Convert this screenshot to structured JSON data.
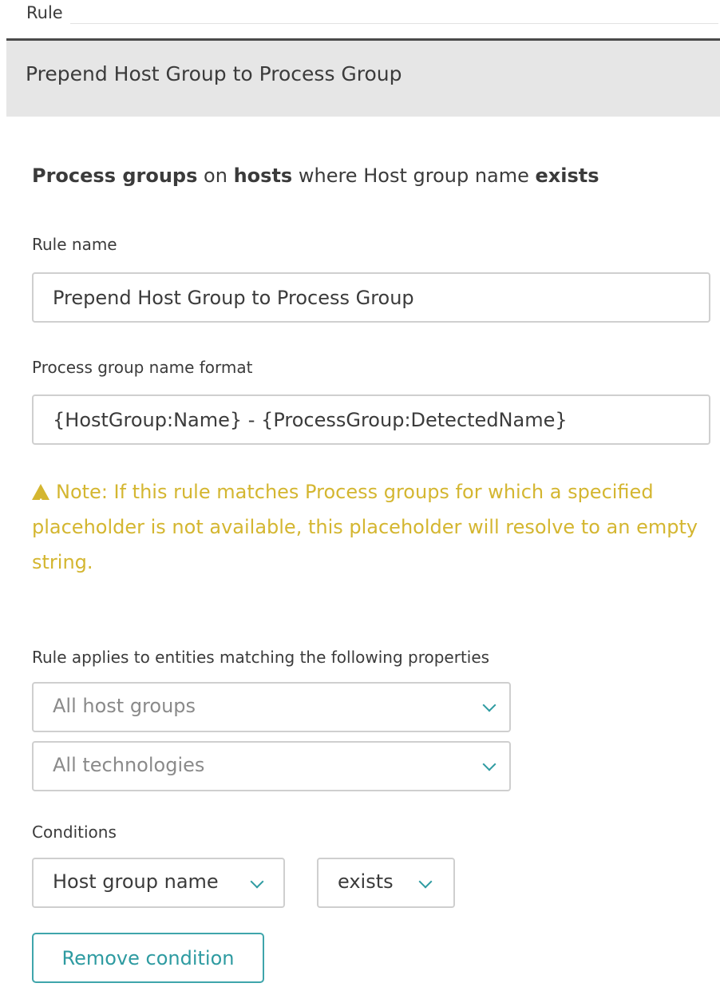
{
  "header": {
    "section_label": "Rule",
    "title": "Prepend Host Group to Process Group"
  },
  "summary": {
    "entity": "Process groups",
    "on_word": "on",
    "scope": "hosts",
    "where_word": "where",
    "property": "Host group name",
    "operator": "exists"
  },
  "rule_name": {
    "label": "Rule name",
    "value": "Prepend Host Group to Process Group"
  },
  "name_format": {
    "label": "Process group name format",
    "value": "{HostGroup:Name} - {ProcessGroup:DetectedName}"
  },
  "warning": {
    "icon": "warning-triangle-icon",
    "text": "Note: If this rule matches Process groups for which a specified placeholder is not available, this placeholder will resolve to an empty string.",
    "color": "#d4b630"
  },
  "applies": {
    "label": "Rule applies to entities matching the following properties",
    "host_groups_placeholder": "All host groups",
    "technologies_placeholder": "All technologies"
  },
  "conditions": {
    "label": "Conditions",
    "property_value": "Host group name",
    "operator_value": "exists",
    "remove_label": "Remove condition"
  },
  "colors": {
    "accent": "#2e9ba1",
    "title_bar_bg": "#e6e6e6"
  }
}
